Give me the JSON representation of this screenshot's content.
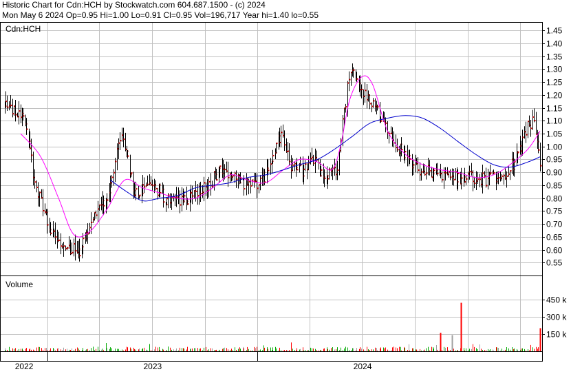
{
  "header": {
    "line1": "Historic Chart for Cdn:HCH by Stockwatch.com 604.687.1500 - (c) 2024",
    "line2": "Mon May  6 2024  Op=0.95  Hi=1.00  Lo=0.91  Cl=0.95  Vol=196,717  Year hi=1.40  lo=0.55"
  },
  "colors": {
    "background": "#ffffff",
    "grid": "#c0c0c0",
    "price_bar": "#000000",
    "close_tick": "#cc0000",
    "ma_short": "#ff00ff",
    "ma_long": "#0000cc",
    "volume_up": "#00aa00",
    "volume_down": "#ff0000",
    "volume_flat": "#a0a0a0"
  },
  "chart_data": [
    {
      "type": "line",
      "title": "Cdn:HCH",
      "ylim": [
        0.5,
        1.48
      ],
      "yticks": [
        "0.55",
        "0.60",
        "0.65",
        "0.70",
        "0.75",
        "0.80",
        "0.85",
        "0.90",
        "0.95",
        "1.00",
        "1.05",
        "1.10",
        "1.15",
        "1.20",
        "1.25",
        "1.30",
        "1.35",
        "1.40",
        "1.45"
      ],
      "x_labels": [
        "2022",
        "2023",
        "2024"
      ],
      "x_range": [
        "2021-10-15",
        "2024-05-06"
      ],
      "grid": true,
      "price_keypoints": {
        "x": [
          "2021-10-15",
          "2021-11-20",
          "2021-12-10",
          "2022-01-05",
          "2022-02-01",
          "2022-02-25",
          "2022-03-20",
          "2022-04-15",
          "2022-05-10",
          "2022-06-01",
          "2022-07-01",
          "2022-08-01",
          "2022-09-01",
          "2022-10-01",
          "2022-11-01",
          "2022-12-01",
          "2023-01-01",
          "2023-01-20",
          "2023-02-10",
          "2023-03-01",
          "2023-03-20",
          "2023-04-10",
          "2023-04-25",
          "2023-05-20",
          "2023-06-10",
          "2023-07-01",
          "2023-08-01",
          "2023-09-01",
          "2023-10-01",
          "2023-11-01",
          "2023-12-01",
          "2024-01-01",
          "2024-02-01",
          "2024-03-01",
          "2024-03-25",
          "2024-04-10",
          "2024-04-25",
          "2024-05-06"
        ],
        "close": [
          1.16,
          1.12,
          0.86,
          0.68,
          0.6,
          0.6,
          0.72,
          0.8,
          1.05,
          0.82,
          0.86,
          0.78,
          0.8,
          0.84,
          0.92,
          0.86,
          0.85,
          0.9,
          1.05,
          0.92,
          0.9,
          0.95,
          0.88,
          0.92,
          1.32,
          1.22,
          1.12,
          1.0,
          0.92,
          0.9,
          0.88,
          0.88,
          0.87,
          0.88,
          0.95,
          1.05,
          1.12,
          0.95
        ]
      },
      "series": [
        {
          "name": "",
          "role": "moving-average-short",
          "x": [
            "2021-11-15",
            "2021-12-20",
            "2022-01-20",
            "2022-02-15",
            "2022-03-15",
            "2022-04-15",
            "2022-05-15",
            "2022-06-15",
            "2022-07-15",
            "2022-08-15",
            "2022-09-15",
            "2022-10-15",
            "2022-11-15",
            "2022-12-15",
            "2023-01-15",
            "2023-02-15",
            "2023-03-15",
            "2023-04-15",
            "2023-05-10",
            "2023-05-25",
            "2023-06-10",
            "2023-07-01",
            "2023-07-20",
            "2023-08-15",
            "2023-09-15",
            "2023-10-15",
            "2023-11-15",
            "2023-12-15",
            "2024-01-15",
            "2024-02-15",
            "2024-03-15",
            "2024-04-15",
            "2024-05-06"
          ],
          "values": [
            1.05,
            0.96,
            0.8,
            0.66,
            0.67,
            0.76,
            0.87,
            0.84,
            0.82,
            0.8,
            0.8,
            0.84,
            0.89,
            0.87,
            0.86,
            0.91,
            0.95,
            0.94,
            0.91,
            1.0,
            1.18,
            1.27,
            1.24,
            1.06,
            0.97,
            0.93,
            0.91,
            0.9,
            0.88,
            0.89,
            0.93,
            0.99,
            1.06
          ]
        },
        {
          "name": "",
          "role": "moving-average-long",
          "x": [
            "2022-04-20",
            "2022-05-15",
            "2022-06-15",
            "2022-07-15",
            "2022-08-15",
            "2022-09-15",
            "2022-10-15",
            "2022-11-15",
            "2022-12-15",
            "2023-01-15",
            "2023-02-15",
            "2023-03-15",
            "2023-04-15",
            "2023-05-15",
            "2023-06-15",
            "2023-07-15",
            "2023-08-15",
            "2023-09-15",
            "2023-10-15",
            "2023-11-15",
            "2023-12-15",
            "2024-01-15",
            "2024-02-15",
            "2024-03-15",
            "2024-04-15",
            "2024-05-06"
          ],
          "values": [
            0.87,
            0.83,
            0.79,
            0.8,
            0.81,
            0.84,
            0.85,
            0.86,
            0.88,
            0.89,
            0.91,
            0.93,
            0.95,
            0.99,
            1.04,
            1.09,
            1.11,
            1.12,
            1.11,
            1.07,
            1.02,
            0.97,
            0.93,
            0.92,
            0.94,
            0.96
          ]
        }
      ]
    },
    {
      "type": "bar",
      "title": "Volume",
      "ylim": [
        0,
        650
      ],
      "yticks": [
        "150 k",
        "300 k",
        "450 k"
      ],
      "grid": true,
      "typical_value": 22,
      "spikes": [
        {
          "x": "2023-11-15",
          "value": 160
        },
        {
          "x": "2023-12-05",
          "value": 140
        },
        {
          "x": "2023-12-20",
          "value": 420
        },
        {
          "x": "2024-05-06",
          "value": 200
        }
      ]
    }
  ]
}
